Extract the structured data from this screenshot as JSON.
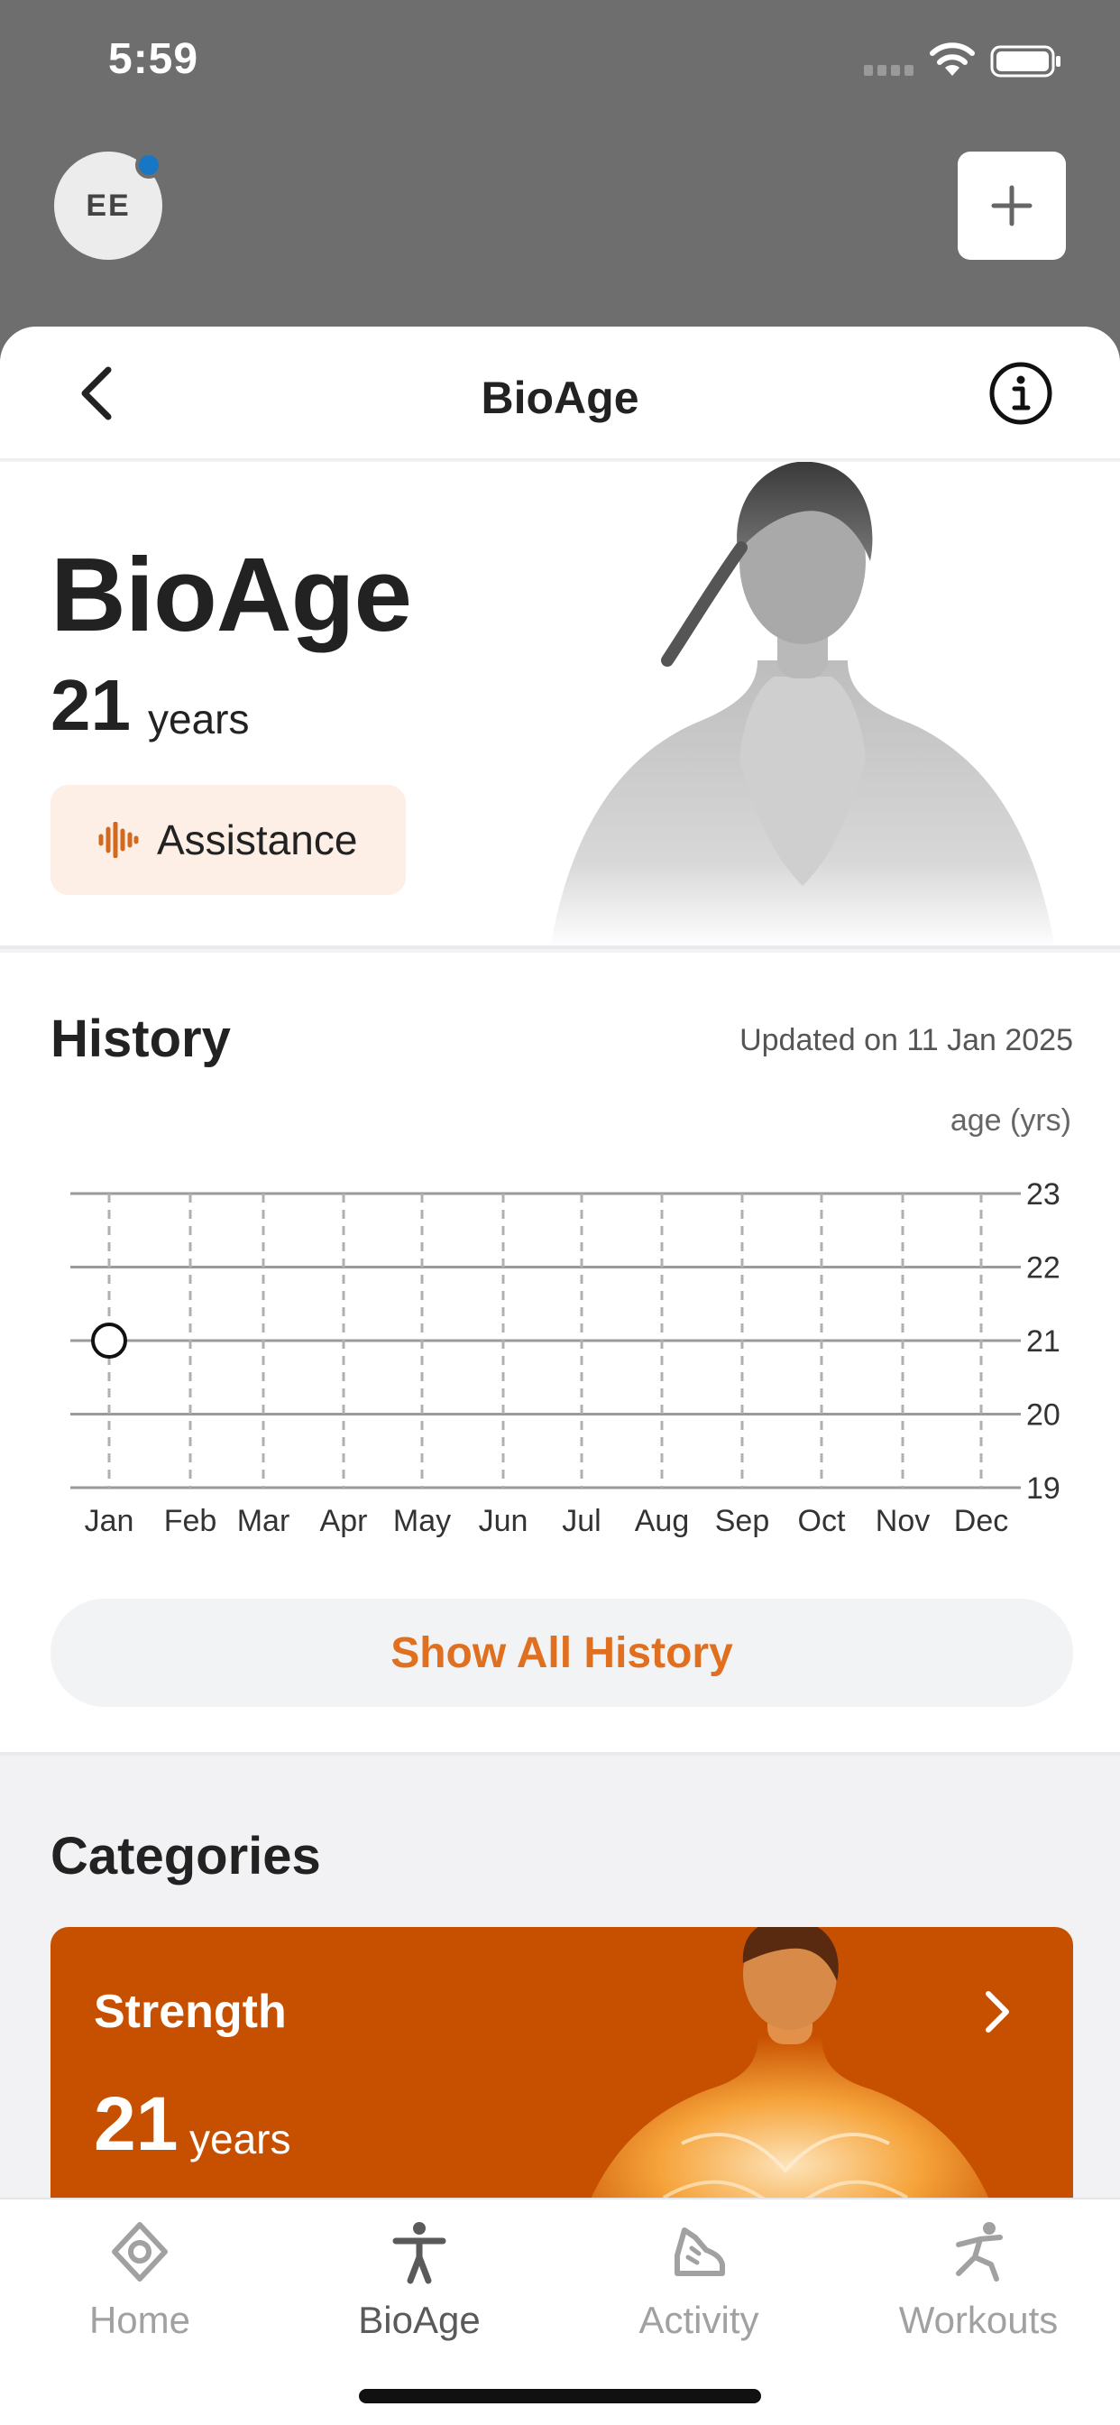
{
  "status_bar": {
    "time": "5:59"
  },
  "header": {
    "avatar_initials": "EE"
  },
  "nav": {
    "title": "BioAge"
  },
  "hero": {
    "title": "BioAge",
    "age_value": "21",
    "age_unit": "years",
    "assistance_label": "Assistance"
  },
  "history": {
    "title": "History",
    "updated": "Updated on 11 Jan 2025",
    "show_all_label": "Show All History"
  },
  "chart_data": {
    "type": "scatter",
    "ylabel": "age (yrs)",
    "categories": [
      "Jan",
      "Feb",
      "Mar",
      "Apr",
      "May",
      "Jun",
      "Jul",
      "Aug",
      "Sep",
      "Oct",
      "Nov",
      "Dec"
    ],
    "yticks": [
      23,
      22,
      21,
      20,
      19
    ],
    "ylim": [
      19,
      23
    ],
    "grid": true,
    "points": [
      {
        "x": "Jan",
        "y": 21
      }
    ]
  },
  "categories": {
    "title": "Categories",
    "items": [
      {
        "label": "Strength",
        "value": "21",
        "unit": "years"
      }
    ]
  },
  "tabs": [
    {
      "label": "Home",
      "icon": "home-icon"
    },
    {
      "label": "BioAge",
      "icon": "person-icon"
    },
    {
      "label": "Activity",
      "icon": "activity-icon"
    },
    {
      "label": "Workouts",
      "icon": "workouts-icon"
    }
  ],
  "colors": {
    "accent": "#e0701f",
    "strength_card": "#c75000",
    "notification_dot": "#1777c5"
  }
}
